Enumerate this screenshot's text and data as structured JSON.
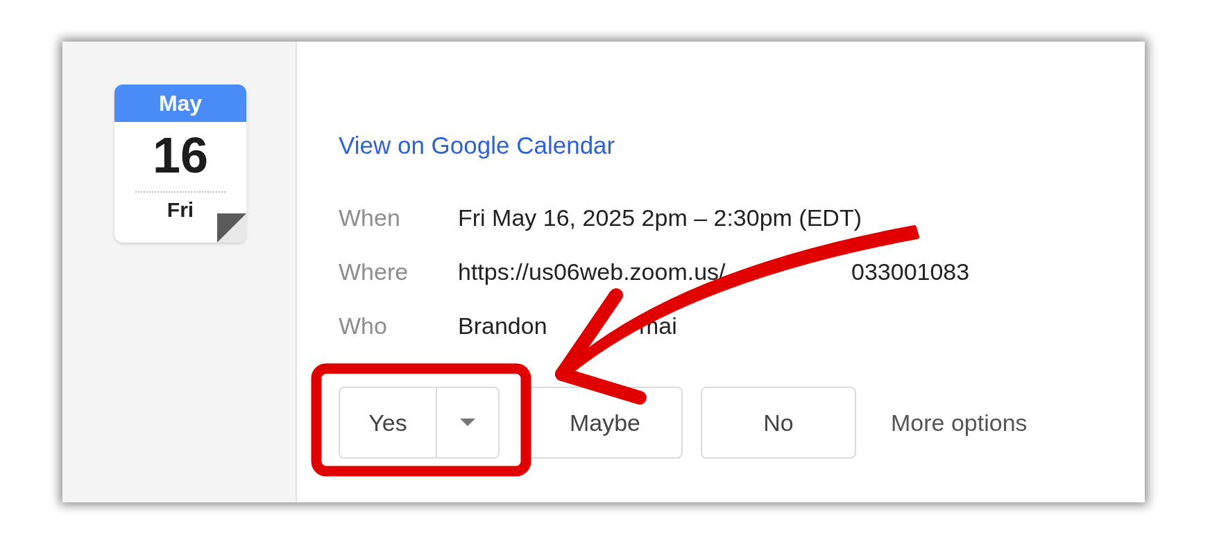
{
  "date_badge": {
    "month": "May",
    "day": "16",
    "weekday": "Fri"
  },
  "calendar_link": "View on Google Calendar",
  "details": [
    {
      "label": "When",
      "value": "Fri May 16, 2025 2pm – 2:30pm (EDT)"
    },
    {
      "label": "Where",
      "value": "https://us06web.zoom.us/",
      "value_tail": "033001083"
    },
    {
      "label": "Who",
      "value": "Brandon",
      "value_tail": "mai"
    }
  ],
  "rsvp_buttons": [
    {
      "label": "Yes",
      "kind": "split"
    },
    {
      "label": "Maybe",
      "kind": "plain"
    },
    {
      "label": "No",
      "kind": "plain"
    }
  ],
  "more_options": "More options"
}
